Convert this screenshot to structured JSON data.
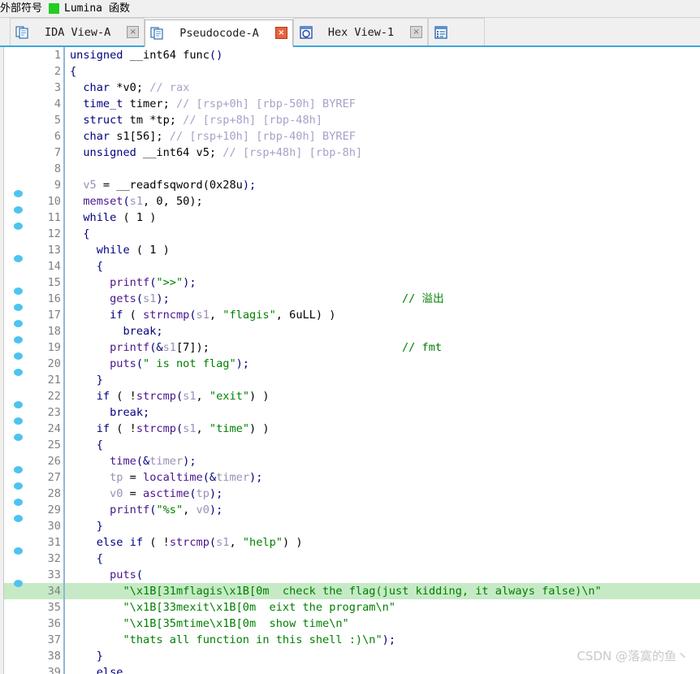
{
  "toolbar": {
    "external_symbols_label": "外部符号",
    "lumina_label": "Lumina",
    "functions_label": "函数",
    "green_indicator_color": "#22cc22"
  },
  "tabs": [
    {
      "label": "IDA View-A",
      "icon": "document-pages-icon",
      "active": false,
      "close_label": "×",
      "close_style": "grey"
    },
    {
      "label": "Pseudocode-A",
      "icon": "document-pages-icon",
      "active": true,
      "close_label": "×",
      "close_style": "red"
    },
    {
      "label": "Hex View-1",
      "icon": "hex-circle-icon",
      "active": false,
      "close_label": "×",
      "close_style": "grey"
    },
    {
      "label": "",
      "icon": "structures-list-icon",
      "active": false,
      "close_label": "",
      "close_style": "none"
    }
  ],
  "editor": {
    "highlighted_line": 34,
    "highlight_color": "#c6eac6",
    "breakpoint_dot_color": "#4ec3f0",
    "lines": [
      {
        "n": 1,
        "dot": false,
        "hl": false,
        "tokens": [
          {
            "t": "unsigned",
            "c": "kw"
          },
          {
            "t": " __int64 ",
            "c": "plain"
          },
          {
            "t": "func",
            "c": "plain"
          },
          {
            "t": "()",
            "c": "pn"
          }
        ]
      },
      {
        "n": 2,
        "dot": false,
        "hl": false,
        "tokens": [
          {
            "t": "{",
            "c": "pn"
          }
        ]
      },
      {
        "n": 3,
        "dot": false,
        "hl": false,
        "tokens": [
          {
            "t": "  ",
            "c": "plain"
          },
          {
            "t": "char",
            "c": "kw"
          },
          {
            "t": " *v0; ",
            "c": "plain"
          },
          {
            "t": "// rax",
            "c": "cmt"
          }
        ]
      },
      {
        "n": 4,
        "dot": false,
        "hl": false,
        "tokens": [
          {
            "t": "  ",
            "c": "plain"
          },
          {
            "t": "time_t",
            "c": "kw"
          },
          {
            "t": " timer; ",
            "c": "plain"
          },
          {
            "t": "// [rsp+0h] [rbp-50h] BYREF",
            "c": "cmt"
          }
        ]
      },
      {
        "n": 5,
        "dot": false,
        "hl": false,
        "tokens": [
          {
            "t": "  ",
            "c": "plain"
          },
          {
            "t": "struct",
            "c": "kw"
          },
          {
            "t": " tm *tp; ",
            "c": "plain"
          },
          {
            "t": "// [rsp+8h] [rbp-48h]",
            "c": "cmt"
          }
        ]
      },
      {
        "n": 6,
        "dot": false,
        "hl": false,
        "tokens": [
          {
            "t": "  ",
            "c": "plain"
          },
          {
            "t": "char",
            "c": "kw"
          },
          {
            "t": " s1[56]; ",
            "c": "plain"
          },
          {
            "t": "// [rsp+10h] [rbp-40h] BYREF",
            "c": "cmt"
          }
        ]
      },
      {
        "n": 7,
        "dot": false,
        "hl": false,
        "tokens": [
          {
            "t": "  ",
            "c": "plain"
          },
          {
            "t": "unsigned",
            "c": "kw"
          },
          {
            "t": " __int64 v5; ",
            "c": "plain"
          },
          {
            "t": "// [rsp+48h] [rbp-8h]",
            "c": "cmt"
          }
        ]
      },
      {
        "n": 8,
        "dot": false,
        "hl": false,
        "tokens": []
      },
      {
        "n": 9,
        "dot": true,
        "hl": false,
        "tokens": [
          {
            "t": "  ",
            "c": "plain"
          },
          {
            "t": "v5",
            "c": "var"
          },
          {
            "t": " = __readfsqword(",
            "c": "plain"
          },
          {
            "t": "0x28u",
            "c": "num"
          },
          {
            "t": ");",
            "c": "pn"
          }
        ]
      },
      {
        "n": 10,
        "dot": true,
        "hl": false,
        "tokens": [
          {
            "t": "  ",
            "c": "plain"
          },
          {
            "t": "memset",
            "c": "fn"
          },
          {
            "t": "(",
            "c": "pn"
          },
          {
            "t": "s1",
            "c": "var"
          },
          {
            "t": ", 0, 50);",
            "c": "plain"
          }
        ]
      },
      {
        "n": 11,
        "dot": true,
        "hl": false,
        "tokens": [
          {
            "t": "  ",
            "c": "plain"
          },
          {
            "t": "while",
            "c": "kw"
          },
          {
            "t": " ( 1 )",
            "c": "plain"
          }
        ]
      },
      {
        "n": 12,
        "dot": false,
        "hl": false,
        "tokens": [
          {
            "t": "  ",
            "c": "plain"
          },
          {
            "t": "{",
            "c": "pn"
          }
        ]
      },
      {
        "n": 13,
        "dot": true,
        "hl": false,
        "tokens": [
          {
            "t": "    ",
            "c": "plain"
          },
          {
            "t": "while",
            "c": "kw"
          },
          {
            "t": " ( 1 )",
            "c": "plain"
          }
        ]
      },
      {
        "n": 14,
        "dot": false,
        "hl": false,
        "tokens": [
          {
            "t": "    ",
            "c": "plain"
          },
          {
            "t": "{",
            "c": "pn"
          }
        ]
      },
      {
        "n": 15,
        "dot": true,
        "hl": false,
        "tokens": [
          {
            "t": "      ",
            "c": "plain"
          },
          {
            "t": "printf",
            "c": "fn"
          },
          {
            "t": "(",
            "c": "pn"
          },
          {
            "t": "\">>\"",
            "c": "str"
          },
          {
            "t": ");",
            "c": "pn"
          }
        ]
      },
      {
        "n": 16,
        "dot": true,
        "hl": false,
        "comment": "// 溢出",
        "tokens": [
          {
            "t": "      ",
            "c": "plain"
          },
          {
            "t": "gets",
            "c": "fn"
          },
          {
            "t": "(",
            "c": "pn"
          },
          {
            "t": "s1",
            "c": "var"
          },
          {
            "t": ");",
            "c": "pn"
          }
        ]
      },
      {
        "n": 17,
        "dot": true,
        "hl": false,
        "tokens": [
          {
            "t": "      ",
            "c": "plain"
          },
          {
            "t": "if",
            "c": "kw"
          },
          {
            "t": " ( ",
            "c": "plain"
          },
          {
            "t": "strncmp",
            "c": "fn"
          },
          {
            "t": "(",
            "c": "pn"
          },
          {
            "t": "s1",
            "c": "var"
          },
          {
            "t": ", ",
            "c": "plain"
          },
          {
            "t": "\"flagis\"",
            "c": "str"
          },
          {
            "t": ", 6uLL) )",
            "c": "plain"
          }
        ]
      },
      {
        "n": 18,
        "dot": true,
        "hl": false,
        "tokens": [
          {
            "t": "        ",
            "c": "plain"
          },
          {
            "t": "break",
            "c": "kw"
          },
          {
            "t": ";",
            "c": "pn"
          }
        ]
      },
      {
        "n": 19,
        "dot": true,
        "hl": false,
        "comment": "// fmt",
        "tokens": [
          {
            "t": "      ",
            "c": "plain"
          },
          {
            "t": "printf",
            "c": "fn"
          },
          {
            "t": "(&",
            "c": "pn"
          },
          {
            "t": "s1",
            "c": "var"
          },
          {
            "t": "[7]);",
            "c": "plain"
          }
        ]
      },
      {
        "n": 20,
        "dot": true,
        "hl": false,
        "tokens": [
          {
            "t": "      ",
            "c": "plain"
          },
          {
            "t": "puts",
            "c": "fn"
          },
          {
            "t": "(",
            "c": "pn"
          },
          {
            "t": "\" is not flag\"",
            "c": "str"
          },
          {
            "t": ");",
            "c": "pn"
          }
        ]
      },
      {
        "n": 21,
        "dot": false,
        "hl": false,
        "tokens": [
          {
            "t": "    ",
            "c": "plain"
          },
          {
            "t": "}",
            "c": "pn"
          }
        ]
      },
      {
        "n": 22,
        "dot": true,
        "hl": false,
        "tokens": [
          {
            "t": "    ",
            "c": "plain"
          },
          {
            "t": "if",
            "c": "kw"
          },
          {
            "t": " ( !",
            "c": "plain"
          },
          {
            "t": "strcmp",
            "c": "fn"
          },
          {
            "t": "(",
            "c": "pn"
          },
          {
            "t": "s1",
            "c": "var"
          },
          {
            "t": ", ",
            "c": "plain"
          },
          {
            "t": "\"exit\"",
            "c": "str"
          },
          {
            "t": ") )",
            "c": "plain"
          }
        ]
      },
      {
        "n": 23,
        "dot": true,
        "hl": false,
        "tokens": [
          {
            "t": "      ",
            "c": "plain"
          },
          {
            "t": "break",
            "c": "kw"
          },
          {
            "t": ";",
            "c": "pn"
          }
        ]
      },
      {
        "n": 24,
        "dot": true,
        "hl": false,
        "tokens": [
          {
            "t": "    ",
            "c": "plain"
          },
          {
            "t": "if",
            "c": "kw"
          },
          {
            "t": " ( !",
            "c": "plain"
          },
          {
            "t": "strcmp",
            "c": "fn"
          },
          {
            "t": "(",
            "c": "pn"
          },
          {
            "t": "s1",
            "c": "var"
          },
          {
            "t": ", ",
            "c": "plain"
          },
          {
            "t": "\"time\"",
            "c": "str"
          },
          {
            "t": ") )",
            "c": "plain"
          }
        ]
      },
      {
        "n": 25,
        "dot": false,
        "hl": false,
        "tokens": [
          {
            "t": "    ",
            "c": "plain"
          },
          {
            "t": "{",
            "c": "pn"
          }
        ]
      },
      {
        "n": 26,
        "dot": true,
        "hl": false,
        "tokens": [
          {
            "t": "      ",
            "c": "plain"
          },
          {
            "t": "time",
            "c": "fn"
          },
          {
            "t": "(&",
            "c": "pn"
          },
          {
            "t": "timer",
            "c": "var"
          },
          {
            "t": ");",
            "c": "pn"
          }
        ]
      },
      {
        "n": 27,
        "dot": true,
        "hl": false,
        "tokens": [
          {
            "t": "      ",
            "c": "plain"
          },
          {
            "t": "tp",
            "c": "var"
          },
          {
            "t": " = ",
            "c": "plain"
          },
          {
            "t": "localtime",
            "c": "fn"
          },
          {
            "t": "(&",
            "c": "pn"
          },
          {
            "t": "timer",
            "c": "var"
          },
          {
            "t": ");",
            "c": "pn"
          }
        ]
      },
      {
        "n": 28,
        "dot": true,
        "hl": false,
        "tokens": [
          {
            "t": "      ",
            "c": "plain"
          },
          {
            "t": "v0",
            "c": "var"
          },
          {
            "t": " = ",
            "c": "plain"
          },
          {
            "t": "asctime",
            "c": "fn"
          },
          {
            "t": "(",
            "c": "pn"
          },
          {
            "t": "tp",
            "c": "var"
          },
          {
            "t": ");",
            "c": "pn"
          }
        ]
      },
      {
        "n": 29,
        "dot": true,
        "hl": false,
        "tokens": [
          {
            "t": "      ",
            "c": "plain"
          },
          {
            "t": "printf",
            "c": "fn"
          },
          {
            "t": "(",
            "c": "pn"
          },
          {
            "t": "\"%s\"",
            "c": "str"
          },
          {
            "t": ", ",
            "c": "plain"
          },
          {
            "t": "v0",
            "c": "var"
          },
          {
            "t": ");",
            "c": "pn"
          }
        ]
      },
      {
        "n": 30,
        "dot": false,
        "hl": false,
        "tokens": [
          {
            "t": "    ",
            "c": "plain"
          },
          {
            "t": "}",
            "c": "pn"
          }
        ]
      },
      {
        "n": 31,
        "dot": true,
        "hl": false,
        "tokens": [
          {
            "t": "    ",
            "c": "plain"
          },
          {
            "t": "else",
            "c": "kw"
          },
          {
            "t": " ",
            "c": "plain"
          },
          {
            "t": "if",
            "c": "kw"
          },
          {
            "t": " ( !",
            "c": "plain"
          },
          {
            "t": "strcmp",
            "c": "fn"
          },
          {
            "t": "(",
            "c": "pn"
          },
          {
            "t": "s1",
            "c": "var"
          },
          {
            "t": ", ",
            "c": "plain"
          },
          {
            "t": "\"help\"",
            "c": "str"
          },
          {
            "t": ") )",
            "c": "plain"
          }
        ]
      },
      {
        "n": 32,
        "dot": false,
        "hl": false,
        "tokens": [
          {
            "t": "    ",
            "c": "plain"
          },
          {
            "t": "{",
            "c": "pn"
          }
        ]
      },
      {
        "n": 33,
        "dot": true,
        "hl": false,
        "tokens": [
          {
            "t": "      ",
            "c": "plain"
          },
          {
            "t": "puts",
            "c": "fn"
          },
          {
            "t": "(",
            "c": "pn"
          }
        ]
      },
      {
        "n": 34,
        "dot": false,
        "hl": true,
        "tokens": [
          {
            "t": "        ",
            "c": "plain"
          },
          {
            "t": "\"\\x1B[31mflagis\\x1B[0m  check the flag(just kidding, it always false)\\n\"",
            "c": "str"
          }
        ]
      },
      {
        "n": 35,
        "dot": false,
        "hl": false,
        "tokens": [
          {
            "t": "        ",
            "c": "plain"
          },
          {
            "t": "\"\\x1B[33mexit\\x1B[0m  eixt the program\\n\"",
            "c": "str"
          }
        ]
      },
      {
        "n": 36,
        "dot": false,
        "hl": false,
        "tokens": [
          {
            "t": "        ",
            "c": "plain"
          },
          {
            "t": "\"\\x1B[35mtime\\x1B[0m  show time\\n\"",
            "c": "str"
          }
        ]
      },
      {
        "n": 37,
        "dot": false,
        "hl": false,
        "tokens": [
          {
            "t": "        ",
            "c": "plain"
          },
          {
            "t": "\"thats all function in this shell :)\\n\"",
            "c": "str"
          },
          {
            "t": ");",
            "c": "pn"
          }
        ]
      },
      {
        "n": 38,
        "dot": false,
        "hl": false,
        "tokens": [
          {
            "t": "    ",
            "c": "plain"
          },
          {
            "t": "}",
            "c": "pn"
          }
        ]
      },
      {
        "n": 39,
        "dot": false,
        "hl": false,
        "tokens": [
          {
            "t": "    ",
            "c": "plain"
          },
          {
            "t": "else",
            "c": "kw"
          }
        ]
      }
    ]
  },
  "watermark": {
    "text": "CSDN @落寞的鱼丶"
  }
}
